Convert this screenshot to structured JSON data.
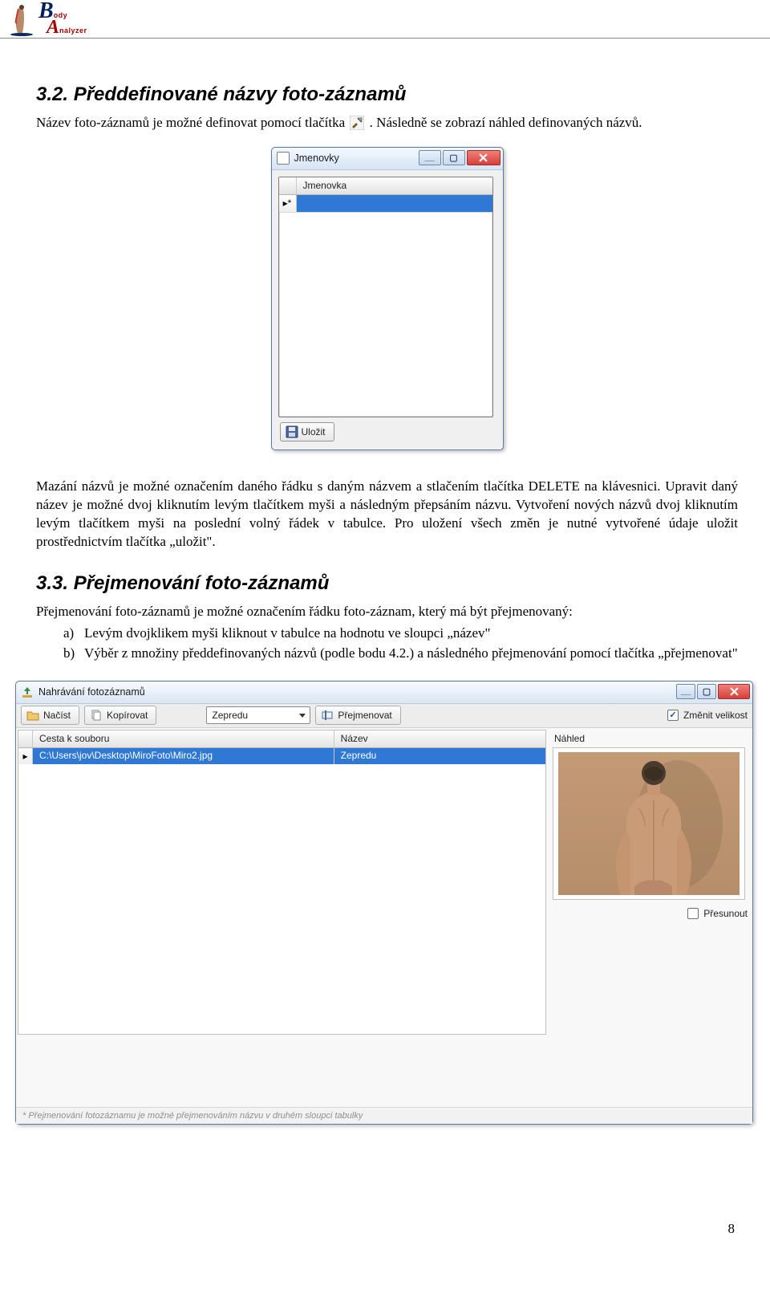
{
  "header": {
    "logo_top": "B",
    "logo_bottom": "A",
    "logo_sub1": "ody",
    "logo_sub2": "nalyzer"
  },
  "sec32": {
    "title": "3.2. Předdefinované názvy foto-záznamů",
    "para1_a": "Název foto-záznamů je možné definovat pomocí tlačítka ",
    "para1_b": ". Následně se zobrazí náhled definovaných názvů.",
    "para2": "Mazání názvů je možné označením daného řádku s daným názvem a stlačením tlačítka DELETE na klávesnici. Upravit daný název je možné dvoj kliknutím levým tlačítkem myši a následným přepsáním názvu. Vytvoření nových názvů dvoj kliknutím levým tlačítkem myši na poslední volný řádek v tabulce. Pro uložení všech změn je nutné vytvořené údaje uložit prostřednictvím tlačítka „uložit\"."
  },
  "win1": {
    "title": "Jmenovky",
    "column": "Jmenovka",
    "save_btn": "Uložit"
  },
  "sec33": {
    "title": "3.3. Přejmenování foto-záznamů",
    "intro": "Přejmenování foto-záznamů je možné označením řádku foto-záznam, který má být přejmenovaný:",
    "li_a": "Levým dvojklikem myši kliknout v tabulce na hodnotu ve sloupci „název\"",
    "li_b": "Výběr z množiny předdefinovaných názvů (podle bodu 4.2.) a následného přejmenování pomocí tlačítka „přejmenovat\""
  },
  "win2": {
    "title": "Nahrávání fotozáznamů",
    "btn_load": "Načíst",
    "btn_copy": "Kopírovat",
    "dd_value": "Zepredu",
    "btn_rename": "Přejmenovat",
    "chk_resize": "Změnit velikost",
    "col_path": "Cesta k souboru",
    "col_name": "Název",
    "row_path": "C:\\Users\\jov\\Desktop\\MiroFoto\\Miro2.jpg",
    "row_name": "Zepredu",
    "preview_label": "Náhled",
    "chk_move": "Přesunout",
    "hint": "* Přejmenování fotozáznamu je možné přejmenováním názvu v druhém sloupci tabulky"
  },
  "page_number": "8",
  "chart_data": null
}
